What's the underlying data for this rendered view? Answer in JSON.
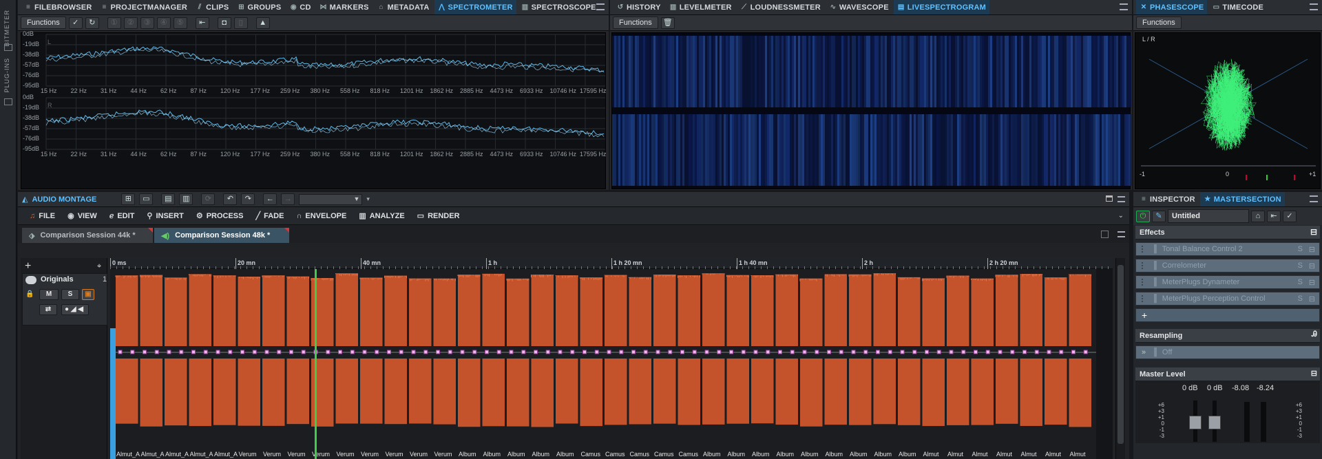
{
  "sidebar": {
    "labels": [
      "BITMETER",
      "PLUG-INS"
    ]
  },
  "top_left_tabs": [
    {
      "label": "FILEBROWSER",
      "icon": "menu-icon"
    },
    {
      "label": "PROJECTMANAGER",
      "icon": "menu-icon"
    },
    {
      "label": "CLIPS",
      "icon": "clips-icon"
    },
    {
      "label": "GROUPS",
      "icon": "grid-icon"
    },
    {
      "label": "CD",
      "icon": "cd-icon"
    },
    {
      "label": "MARKERS",
      "icon": "marker-icon"
    },
    {
      "label": "METADATA",
      "icon": "tag-icon"
    },
    {
      "label": "SPECTROMETER",
      "icon": "spectrometer-icon",
      "active": true
    },
    {
      "label": "SPECTROSCOPE",
      "icon": "bars-icon"
    }
  ],
  "top_mid_tabs": [
    {
      "label": "HISTORY",
      "icon": "history-icon"
    },
    {
      "label": "LEVELMETER",
      "icon": "bars-icon"
    },
    {
      "label": "LOUDNESSMETER",
      "icon": "needle-icon"
    },
    {
      "label": "WAVESCOPE",
      "icon": "wave-icon"
    },
    {
      "label": "LIVESPECTROGRAM",
      "icon": "spectrogram-icon",
      "active": true
    }
  ],
  "top_right_tabs": [
    {
      "label": "PHASESCOPE",
      "icon": "phase-icon",
      "active": true
    },
    {
      "label": "TIMECODE",
      "icon": "timecode-icon"
    }
  ],
  "functions_label": "Functions",
  "spectrometer": {
    "db_labels": [
      "0dB",
      "-19dB",
      "-38dB",
      "-57dB",
      "-76dB",
      "-95dB"
    ],
    "hz_labels": [
      "15 Hz",
      "22 Hz",
      "31 Hz",
      "44 Hz",
      "62 Hz",
      "87 Hz",
      "120 Hz",
      "177 Hz",
      "259 Hz",
      "380 Hz",
      "558 Hz",
      "818 Hz",
      "1201 Hz",
      "1862 Hz",
      "2885 Hz",
      "4473 Hz",
      "6933 Hz",
      "10746 Hz",
      "17595 Hz"
    ],
    "channel_labels": [
      "L",
      "R"
    ]
  },
  "phasescope": {
    "label": "L / R",
    "scale": [
      "-1",
      "0",
      "+1"
    ]
  },
  "montage": {
    "title": "AUDIO MONTAGE",
    "menu": [
      "FILE",
      "VIEW",
      "EDIT",
      "INSERT",
      "PROCESS",
      "FADE",
      "ENVELOPE",
      "ANALYZE",
      "RENDER"
    ],
    "sessions": [
      "Comparison Session 44k *",
      "Comparison Session 48k *"
    ],
    "track_name": "Originals",
    "track_number": "1",
    "track_buttons": [
      "M",
      "S"
    ],
    "ruler": [
      "0 ms",
      "20 mn",
      "40 mn",
      "1 h",
      "1 h 20 mn",
      "1 h 40 mn",
      "2 h",
      "2 h 20 mn"
    ],
    "clip_labels": [
      "Almut_A",
      "Almut_A",
      "Almut_A",
      "Almut_A",
      "Almut_A",
      "Verum",
      "Verum",
      "Verum",
      "Verum",
      "Verum",
      "Verum",
      "Verum",
      "Verum",
      "Verum",
      "Album",
      "Album",
      "Album",
      "Album",
      "Album",
      "Camus",
      "Camus",
      "Camus",
      "Camus",
      "Camus",
      "Album",
      "Album",
      "Album",
      "Album",
      "Album",
      "Album",
      "Album",
      "Album",
      "Album",
      "Almut",
      "Almut",
      "Almut",
      "Almut",
      "Almut",
      "Almut",
      "Almut"
    ]
  },
  "inspector": {
    "tabs": [
      "INSPECTOR",
      "MASTERSECTION"
    ],
    "preset_name": "Untitled",
    "effects_title": "Effects",
    "effects": [
      "Tonal Balance Control 2",
      "Correlometer",
      "MeterPlugs Dynameter",
      "MeterPlugs Perception Control"
    ],
    "resampling_title": "Resampling",
    "resampling_value": "Off",
    "master_level_title": "Master Level",
    "master_values": [
      "0 dB",
      "0 dB",
      "-8.08",
      "-8.24"
    ],
    "scale": [
      "+6",
      "+3",
      "+1",
      "0",
      "-1",
      "-3"
    ]
  },
  "colors": {
    "accent": "#4fb6ff",
    "clip": "#c4532b",
    "track_bg": "#1b1d20",
    "panel": "#2b2e32"
  }
}
